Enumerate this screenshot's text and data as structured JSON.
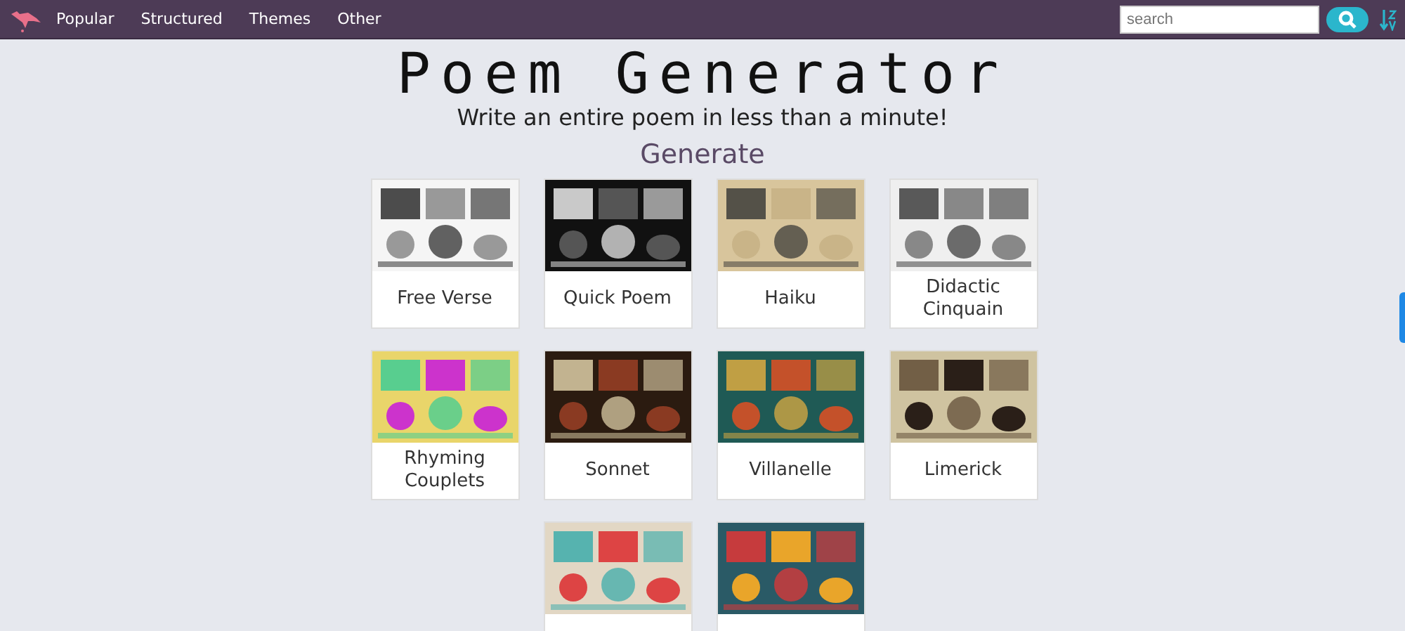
{
  "navbar": {
    "links": [
      "Popular",
      "Structured",
      "Themes",
      "Other"
    ],
    "search": {
      "placeholder": "search"
    }
  },
  "header": {
    "title": "Poem Generator",
    "subtitle": "Write an entire poem in less than a minute!"
  },
  "section": {
    "heading": "Generate"
  },
  "cards": [
    {
      "kind": "titled",
      "label": "Free Verse"
    },
    {
      "kind": "titled",
      "label": "Quick Poem"
    },
    {
      "kind": "titled",
      "label": "Haiku"
    },
    {
      "kind": "titled",
      "label": "Didactic Cinquain"
    },
    {
      "kind": "titled",
      "label": "Rhyming Couplets"
    },
    {
      "kind": "titled",
      "label": "Sonnet"
    },
    {
      "kind": "titled",
      "label": "Villanelle"
    },
    {
      "kind": "titled",
      "label": "Limerick"
    },
    {
      "kind": "picture"
    },
    {
      "kind": "picture"
    }
  ]
}
